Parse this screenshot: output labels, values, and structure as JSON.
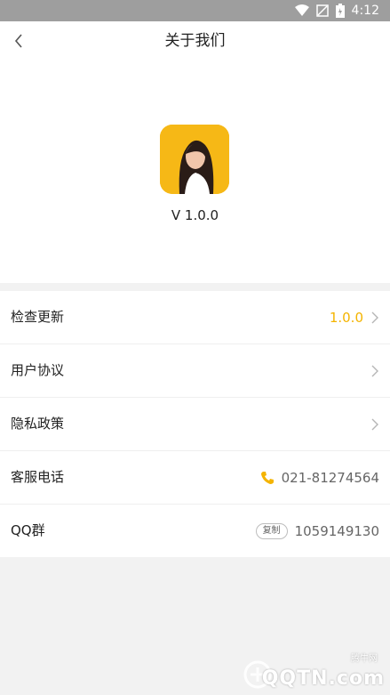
{
  "statusbar": {
    "time": "4:12",
    "icons": [
      "wifi-icon",
      "signal-icon",
      "battery-icon"
    ]
  },
  "header": {
    "title": "关于我们",
    "back_icon": "chevron-left-icon"
  },
  "app": {
    "version": "V 1.0.0",
    "icon": "app-icon"
  },
  "list": {
    "check_update": {
      "label": "检查更新",
      "value": "1.0.0"
    },
    "user_agreement": {
      "label": "用户协议"
    },
    "privacy_policy": {
      "label": "隐私政策"
    },
    "customer_phone": {
      "label": "客服电话",
      "value": "021-81274564"
    },
    "qq_group": {
      "label": "QQ群",
      "copy_label": "复制",
      "value": "1059149130"
    }
  },
  "watermark": {
    "text": "QQTN.com",
    "small": "腾牛网"
  },
  "colors": {
    "accent": "#f4b400",
    "background": "#f2f2f2"
  }
}
